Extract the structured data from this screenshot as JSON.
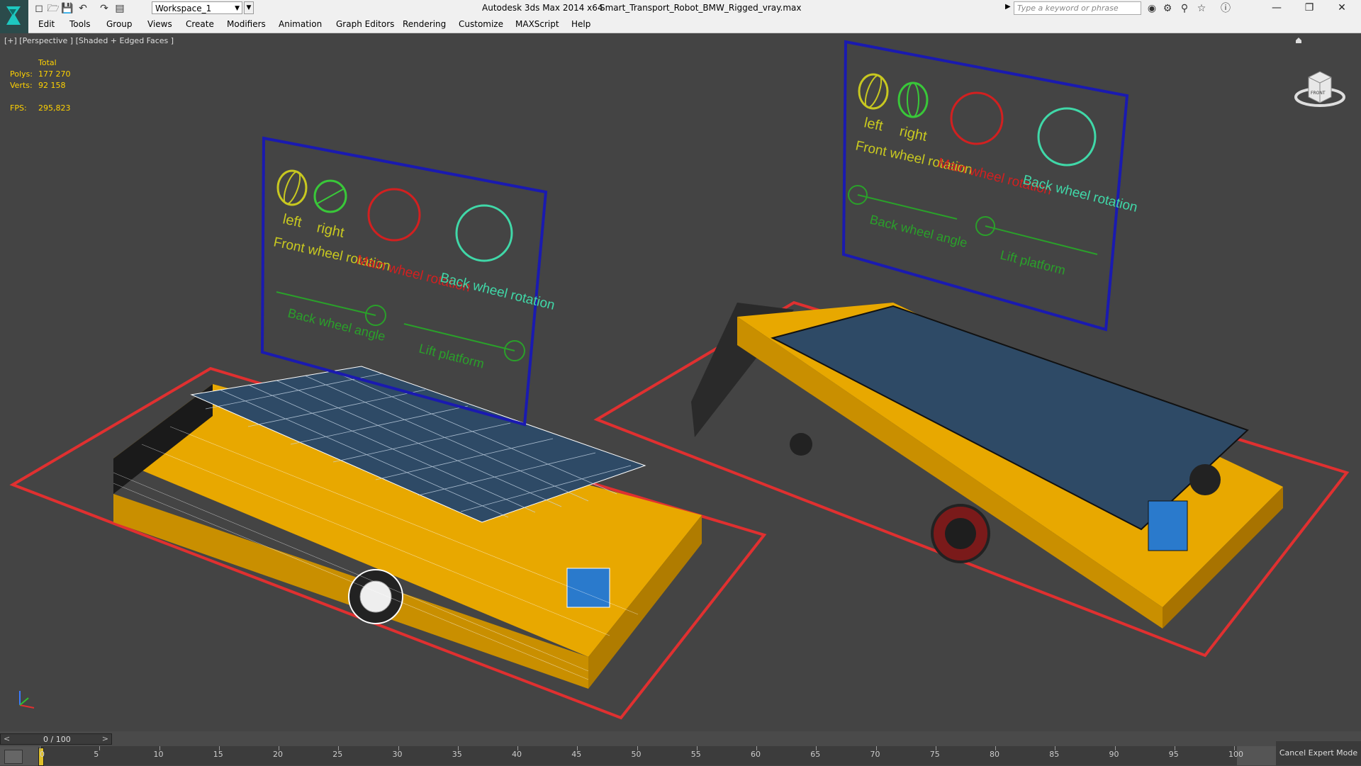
{
  "titlebar": {
    "workspace": "Workspace_1",
    "app_title": "Autodesk 3ds Max  2014 x64",
    "file_name": "Smart_Transport_Robot_BMW_Rigged_vray.max",
    "search_placeholder": "Type a keyword or phrase"
  },
  "menubar": {
    "items": [
      "Edit",
      "Tools",
      "Group",
      "Views",
      "Create",
      "Modifiers",
      "Animation",
      "Graph Editors",
      "Rendering",
      "Customize",
      "MAXScript",
      "Help"
    ]
  },
  "viewport": {
    "label": "[+] [Perspective ] [Shaded + Edged Faces ]",
    "stats": {
      "header": "Total",
      "polys_label": "Polys:",
      "polys_value": "177 270",
      "verts_label": "Verts:",
      "verts_value": "92 158",
      "fps_label": "FPS:",
      "fps_value": "295,823"
    },
    "viewcube_label": "FRONT",
    "panel_labels": {
      "left": "left",
      "right": "right",
      "front_wheel_rotation": "Front wheel rotation",
      "main_wheel_rotation": "Main wheel rotation",
      "back_wheel_rotation": "Back wheel rotation",
      "back_wheel_angle": "Back wheel angle",
      "lift_platform": "Lift platform"
    },
    "colors": {
      "panel_frame": "#1a1ab0",
      "left_circle": "#c8c820",
      "right_circle": "#39c839",
      "main_circle": "#d22020",
      "back_circle": "#40d8a8",
      "slider_green": "#2aa02a",
      "floor_frame": "#e03030",
      "robot_yellow": "#e8a800",
      "robot_top": "#2e4a66"
    }
  },
  "timeline": {
    "position": "0 / 100",
    "prev": "<",
    "next": ">",
    "ticks": [
      "0",
      "5",
      "10",
      "15",
      "20",
      "25",
      "30",
      "35",
      "40",
      "45",
      "50",
      "55",
      "60",
      "65",
      "70",
      "75",
      "80",
      "85",
      "90",
      "95",
      "100"
    ],
    "cancel_expert": "Cancel Expert Mode"
  }
}
